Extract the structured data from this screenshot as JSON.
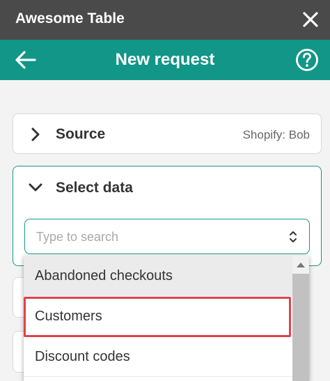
{
  "window": {
    "title": "Awesome Table"
  },
  "header": {
    "title": "New request"
  },
  "source": {
    "label": "Source",
    "value": "Shopify: Bob"
  },
  "select_data": {
    "label": "Select data",
    "search_placeholder": "Type to search"
  },
  "dropdown": {
    "items": [
      "Abandoned checkouts",
      "Customers",
      "Discount codes"
    ],
    "hovered": "Abandoned checkouts",
    "highlighted": "Customers"
  },
  "colors": {
    "titlebar": "#4a4a4a",
    "accent": "#129688",
    "highlight_border": "#e0434b"
  }
}
